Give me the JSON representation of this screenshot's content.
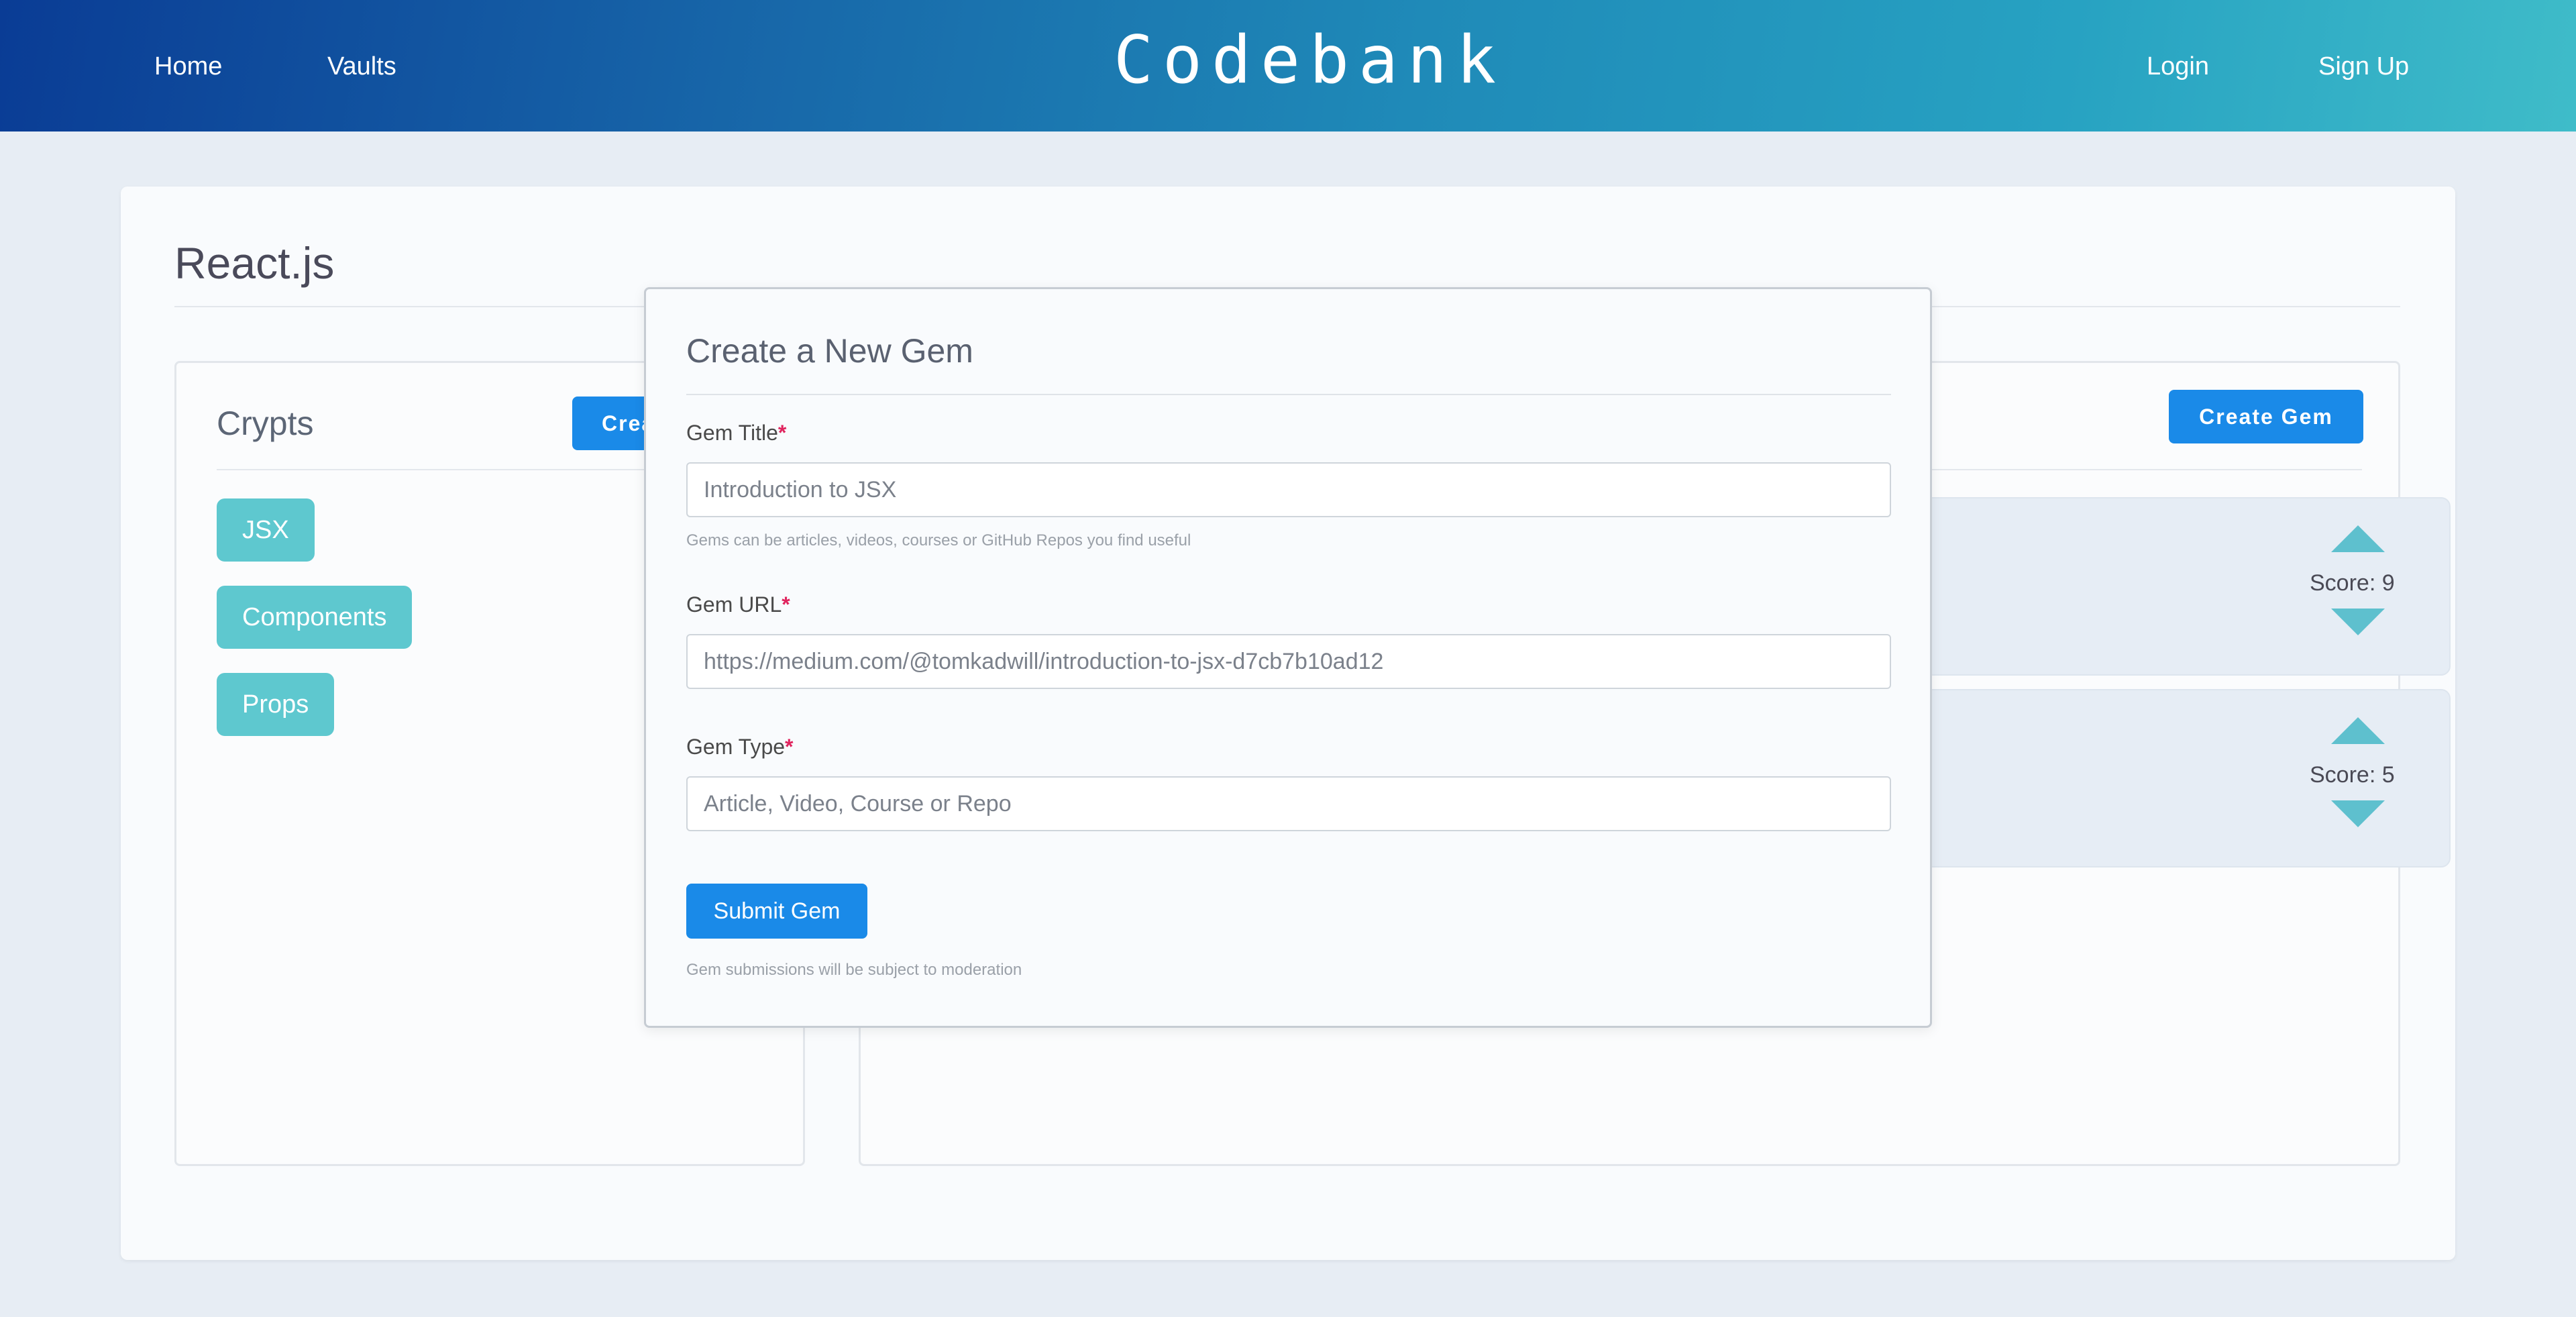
{
  "navbar": {
    "brand": "Codebank",
    "links_left": [
      "Home",
      "Vaults"
    ],
    "links_right": [
      "Login",
      "Sign Up"
    ]
  },
  "page": {
    "title": "React.js"
  },
  "crypts_panel": {
    "heading": "Crypts",
    "create_button": "Crea",
    "tags": [
      "JSX",
      "Components",
      "Props"
    ]
  },
  "gems_panel": {
    "create_button": "Create Gem",
    "gems": [
      {
        "score_label": "Score: 9"
      },
      {
        "score_label": "Score: 5"
      }
    ]
  },
  "modal": {
    "title": "Create a New Gem",
    "fields": {
      "title": {
        "label": "Gem Title",
        "required_mark": "*",
        "placeholder": "Introduction to JSX",
        "help": "Gems can be articles, videos, courses or GitHub Repos you find useful"
      },
      "url": {
        "label": "Gem URL",
        "required_mark": "*",
        "placeholder": "https://medium.com/@tomkadwill/introduction-to-jsx-d7cb7b10ad12"
      },
      "type": {
        "label": "Gem Type",
        "required_mark": "*",
        "placeholder": "Article, Video, Course or Repo"
      }
    },
    "submit_button": "Submit Gem",
    "footer_note": "Gem submissions will be subject to moderation"
  },
  "colors": {
    "primary_button": "#1a8ae8",
    "tag": "#5ec8cf",
    "vote_arrow": "#5ec0ce",
    "required": "#e0245e",
    "background": "#e7edf4"
  }
}
